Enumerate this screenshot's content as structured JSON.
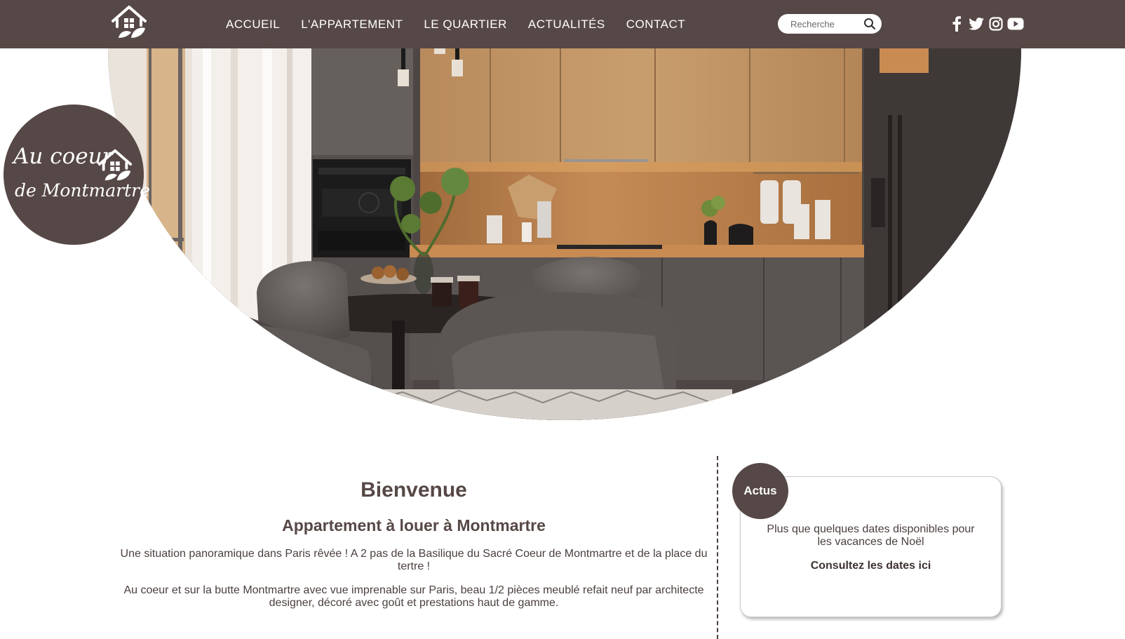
{
  "header": {
    "nav": [
      "ACCUEIL",
      "L'APPARTEMENT",
      "LE QUARTIER",
      "ACTUALITÉS",
      "CONTACT"
    ],
    "search_placeholder": "Recherche",
    "social_icons": [
      "facebook-icon",
      "twitter-icon",
      "instagram-icon",
      "youtube-icon"
    ]
  },
  "badge": {
    "line1": "Au coeur",
    "line2": "de Montmartre"
  },
  "main": {
    "title": "Bienvenue",
    "subtitle": "Appartement à louer à Montmartre",
    "paragraph1": "Une situation panoramique dans Paris rêvée ! A 2 pas de la Basilique du Sacré Coeur de Montmartre et de la place du tertre !",
    "paragraph2": "Au coeur et sur la butte Montmartre avec vue imprenable sur Paris, beau 1/2 pièces meublé refait neuf par architecte designer, décoré avec goût et prestations haut de gamme."
  },
  "actus": {
    "label": "Actus",
    "message": "Plus que quelques dates disponibles pour les vacances de Noël",
    "link": "Consultez les dates ici"
  },
  "colors": {
    "brand": "#564846",
    "text": "#4a3f3d",
    "background": "#ffffff"
  }
}
